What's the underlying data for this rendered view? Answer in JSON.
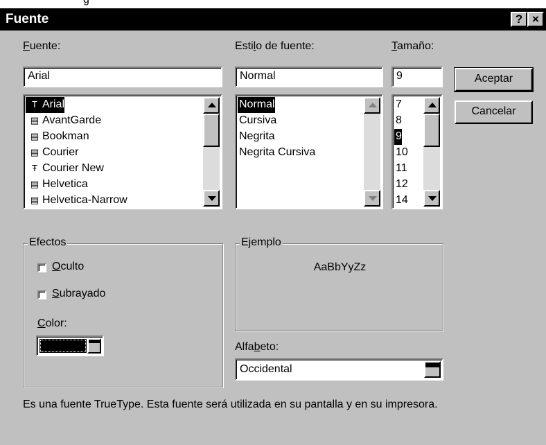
{
  "background_fragment": "g",
  "dialog": {
    "title": "Fuente",
    "help_button": "?",
    "close_button": "×"
  },
  "font": {
    "label_first": "F",
    "label_rest": "uente:",
    "value": "Arial",
    "items": [
      {
        "icon": "truetype-icon",
        "glyph": "T",
        "label": "Arial",
        "selected": true
      },
      {
        "icon": "printer-font-icon",
        "glyph": "▤",
        "label": "AvantGarde"
      },
      {
        "icon": "printer-font-icon",
        "glyph": "▤",
        "label": "Bookman"
      },
      {
        "icon": "printer-font-icon",
        "glyph": "▤",
        "label": "Courier"
      },
      {
        "icon": "truetype-icon",
        "glyph": "Ŧ",
        "label": "Courier New"
      },
      {
        "icon": "printer-font-icon",
        "glyph": "▤",
        "label": "Helvetica"
      },
      {
        "icon": "printer-font-icon",
        "glyph": "▤",
        "label": "Helvetica-Narrow"
      }
    ]
  },
  "style": {
    "label_pre": "Esti",
    "label_u": "l",
    "label_post": "o de fuente:",
    "value": "Normal",
    "items": [
      "Normal",
      "Cursiva",
      "Negrita",
      "Negrita Cursiva"
    ],
    "selected_index": 0
  },
  "size": {
    "label_u": "T",
    "label_rest": "amaño:",
    "value": "9",
    "items": [
      "7",
      "8",
      "9",
      "10",
      "11",
      "12",
      "14"
    ],
    "selected_index": 2
  },
  "buttons": {
    "ok": "Aceptar",
    "cancel": "Cancelar"
  },
  "effects": {
    "title": "Efectos",
    "hidden_u": "O",
    "hidden_rest": "culto",
    "hidden_checked": false,
    "underline_u": "S",
    "underline_rest": "ubrayado",
    "underline_checked": false,
    "color_u": "C",
    "color_rest": "olor:",
    "color_value": "#000000"
  },
  "sample": {
    "title": "Ejemplo",
    "text": "AaBbYyZz"
  },
  "script": {
    "label_pre": "Alfa",
    "label_u": "b",
    "label_post": "eto:",
    "value": "Occidental"
  },
  "description": "Es una fuente TrueType. Esta fuente será utilizada en su pantalla y en su impresora."
}
